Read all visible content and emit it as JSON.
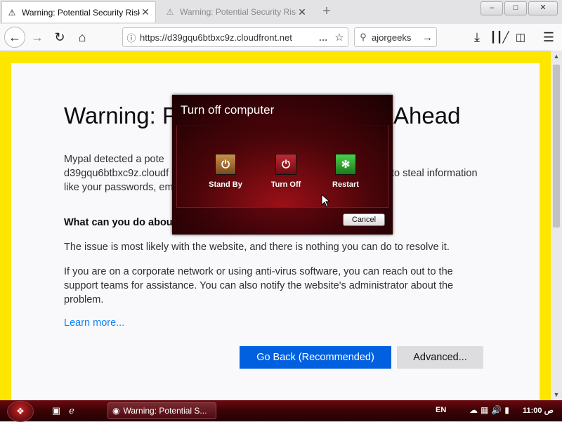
{
  "browser": {
    "tabs": [
      {
        "title": "Warning: Potential Security Risk Ahead",
        "icon": "warning-icon",
        "active": true
      },
      {
        "title": "Warning: Potential Security Risk Ahead",
        "icon": "warning-icon",
        "active": false
      }
    ],
    "url": "https://d39gqu6btbxc9z.cloudfront.net",
    "search_value": "ajorgeeks"
  },
  "page": {
    "heading_start": "Warning: P",
    "heading_end": "Ahead",
    "para1_line1": "Mypal detected a pote",
    "para1_line2": "d39gqu6btbxc9z.cloudf",
    "para1_line2_tail": "to steal information",
    "para1_line3": "like your passwords, em",
    "what_heading": "What can you do abou",
    "para2": "The issue is most likely with the website, and there is nothing you can do to resolve it.",
    "para3": "If you are on a corporate network or using anti-virus software, you can reach out to the support teams for assistance. You can also notify the website's administrator about the problem.",
    "learn_more": "Learn more...",
    "go_back": "Go Back (Recommended)",
    "advanced": "Advanced..."
  },
  "dialog": {
    "title": "Turn off computer",
    "options": [
      {
        "label": "Stand By",
        "icon": "standby-icon",
        "color": "#b07a3c"
      },
      {
        "label": "Turn Off",
        "icon": "power-icon",
        "color": "#a0202a"
      },
      {
        "label": "Restart",
        "icon": "restart-icon",
        "color": "#2fa82f"
      }
    ],
    "cancel": "Cancel"
  },
  "taskbar": {
    "task_title": "Warning: Potential S...",
    "language": "EN",
    "clock": "11:00 ص"
  },
  "colors": {
    "page_border": "#ffe600",
    "primary_button": "#0060df",
    "link": "#0a84ff",
    "dialog_bg": "#5a060c",
    "taskbar": "#3a0306"
  }
}
